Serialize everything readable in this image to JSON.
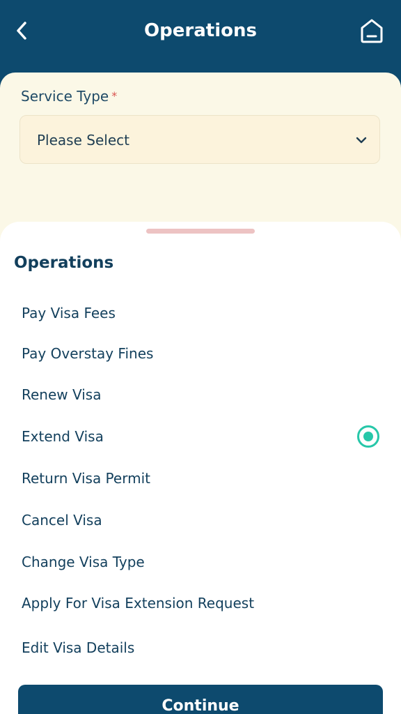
{
  "header": {
    "title": "Operations",
    "back_icon": "chevron-left-icon",
    "home_icon": "home-icon"
  },
  "form": {
    "service_type_label": "Service Type",
    "required_mark": "*",
    "select_placeholder": "Please Select"
  },
  "sheet": {
    "title": "Operations",
    "options": [
      {
        "label": "Pay Visa Fees",
        "selected": false
      },
      {
        "label": "Pay Overstay Fines",
        "selected": false
      },
      {
        "label": "Renew Visa",
        "selected": false
      },
      {
        "label": "Extend Visa",
        "selected": true
      },
      {
        "label": "Return Visa Permit",
        "selected": false
      },
      {
        "label": "Cancel Visa",
        "selected": false
      },
      {
        "label": "Change Visa Type",
        "selected": false
      },
      {
        "label": "Apply For Visa Extension Request",
        "selected": false
      },
      {
        "label": "Edit Visa Details",
        "selected": false
      }
    ],
    "continue_label": "Continue"
  },
  "colors": {
    "primary": "#0d4a6e",
    "accent": "#27c7a9",
    "required": "#d9534f"
  }
}
